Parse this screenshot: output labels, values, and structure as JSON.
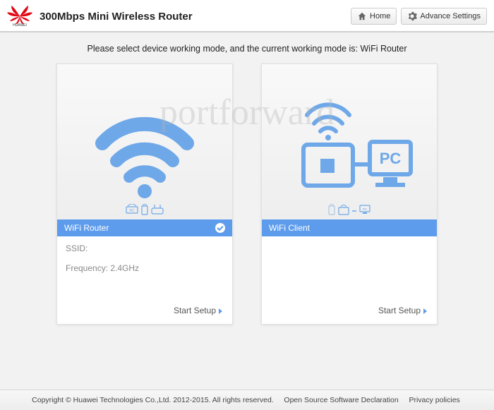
{
  "header": {
    "title": "300Mbps Mini Wireless Router",
    "home": "Home",
    "advance": "Advance Settings"
  },
  "instruction": "Please select device working mode, and the current working mode is: WiFi Router",
  "cards": {
    "router": {
      "mode_label": "WiFi Router",
      "ssid_label": "SSID:",
      "ssid_value": "",
      "freq": "Frequency: 2.4GHz",
      "setup": "Start Setup"
    },
    "client": {
      "mode_label": "WiFi Client",
      "setup": "Start Setup"
    }
  },
  "watermark": "portforward",
  "footer": {
    "copyright": "Copyright © Huawei Technologies Co.,Ltd. 2012-2015. All rights reserved.",
    "link1": "Open Source Software Declaration",
    "link2": "Privacy policies"
  }
}
